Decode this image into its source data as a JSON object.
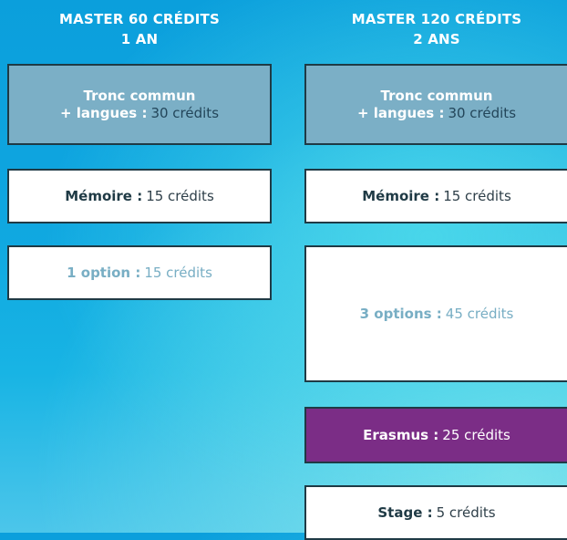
{
  "left": {
    "title_line1": "MASTER 60 CRÉDITS",
    "title_line2": "1 AN",
    "tronc": {
      "line1": "Tronc commun",
      "label": "+ langues :",
      "credits": "30 crédits"
    },
    "memoire": {
      "label": "Mémoire :",
      "credits": "15 crédits"
    },
    "option": {
      "label": "1 option :",
      "credits": "15 crédits"
    }
  },
  "right": {
    "title_line1": "MASTER 120 CRÉDITS",
    "title_line2": "2 ANS",
    "tronc": {
      "line1": "Tronc commun",
      "label": "+ langues :",
      "credits": "30 crédits"
    },
    "memoire": {
      "label": "Mémoire :",
      "credits": "15 crédits"
    },
    "options": {
      "label": "3 options :",
      "credits": "45 crédits"
    },
    "erasmus": {
      "label": "Erasmus :",
      "credits": "25 crédits"
    },
    "stage": {
      "label": "Stage :",
      "credits": "5 crédits"
    }
  },
  "colors": {
    "background": "#0fa6e0",
    "tronc": "#7bafc6",
    "erasmus": "#7b2d86",
    "border": "#1f3a45",
    "light_text": "#78aec4"
  }
}
